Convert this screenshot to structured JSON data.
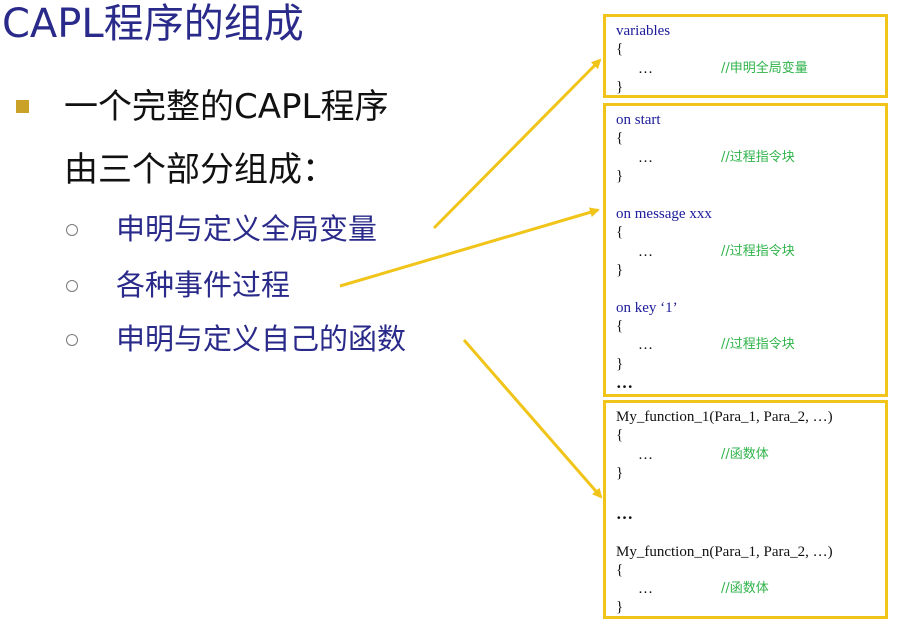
{
  "title": "CAPL程序的组成",
  "main_point": {
    "line1": "一个完整的CAPL程序",
    "line2": "由三个部分组成："
  },
  "sub_points": [
    "申明与定义全局变量",
    "各种事件过程",
    "申明与定义自己的函数"
  ],
  "code_box_1": {
    "keyword": "variables",
    "open": "{",
    "dots": "…",
    "comment": "//申明全局变量",
    "close": "}"
  },
  "code_box_2": {
    "events": [
      {
        "header": "on start",
        "comment": "//过程指令块"
      },
      {
        "header": "on message xxx",
        "comment": "//过程指令块"
      },
      {
        "header": "on key ‘1’",
        "comment": "//过程指令块"
      }
    ],
    "open": "{",
    "dots": "…",
    "close": "}",
    "more": "…"
  },
  "code_box_3": {
    "func1": "My_function_1(Para_1, Para_2, …)",
    "func1_comment": "//函数体",
    "middle": "…",
    "func2": "My_function_n(Para_1, Para_2, …)",
    "func2_comment": "//函数体",
    "open": "{",
    "dots": "…",
    "close": "}"
  },
  "colors": {
    "title": "#2a2a8a",
    "box_border": "#f0c419",
    "arrow": "#f0c419",
    "comment": "#2fb34a",
    "keyword": "#1a1a9a"
  }
}
